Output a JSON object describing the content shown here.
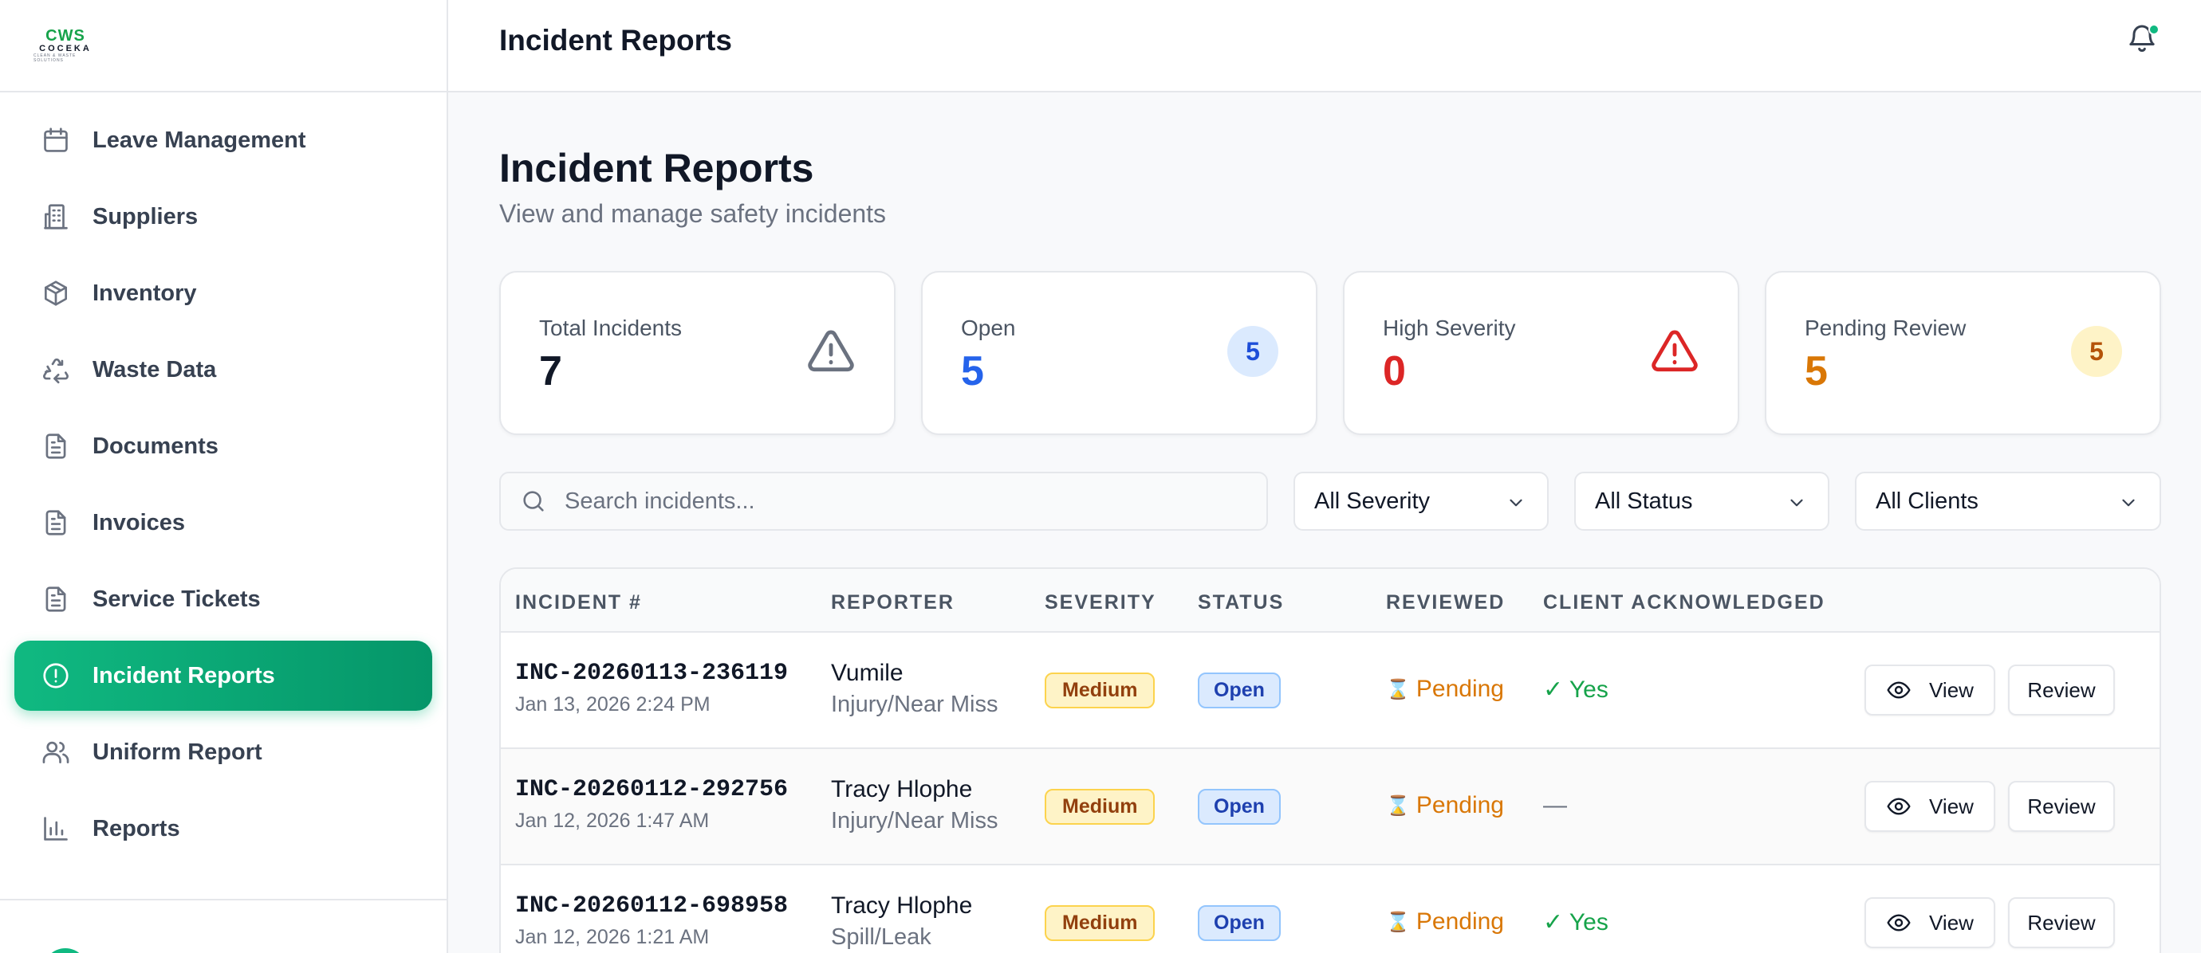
{
  "brand": {
    "mark": "CWS",
    "word": "COCEKA",
    "tag": "CLEAN & WASTE SOLUTIONS"
  },
  "sidebar": {
    "items": [
      {
        "label": "Leave Management",
        "icon": "calendar-icon"
      },
      {
        "label": "Suppliers",
        "icon": "building-icon"
      },
      {
        "label": "Inventory",
        "icon": "box-icon"
      },
      {
        "label": "Waste Data",
        "icon": "recycle-icon"
      },
      {
        "label": "Documents",
        "icon": "document-icon"
      },
      {
        "label": "Invoices",
        "icon": "document-icon"
      },
      {
        "label": "Service Tickets",
        "icon": "document-icon"
      },
      {
        "label": "Incident Reports",
        "icon": "alert-circle-icon"
      },
      {
        "label": "Uniform Report",
        "icon": "users-icon"
      },
      {
        "label": "Reports",
        "icon": "bar-chart-icon"
      }
    ],
    "active": "Incident Reports"
  },
  "header": {
    "title": "Incident Reports"
  },
  "page": {
    "title": "Incident Reports",
    "subtitle": "View and manage safety incidents"
  },
  "stats": [
    {
      "label": "Total Incidents",
      "value": "7",
      "color": "#111827",
      "icon": "warning-triangle-icon"
    },
    {
      "label": "Open",
      "value": "5",
      "color": "#2563eb",
      "badge": "5",
      "badge_bg": "#dbeafe"
    },
    {
      "label": "High Severity",
      "value": "0",
      "color": "#dc2626",
      "icon": "warning-triangle-icon"
    },
    {
      "label": "Pending Review",
      "value": "5",
      "color": "#d97706",
      "badge": "5",
      "badge_bg": "#fef3c7"
    }
  ],
  "filters": {
    "search_placeholder": "Search incidents...",
    "severity": "All Severity",
    "status": "All Status",
    "clients": "All Clients"
  },
  "table": {
    "headers": [
      "INCIDENT #",
      "REPORTER",
      "SEVERITY",
      "STATUS",
      "REVIEWED",
      "CLIENT ACKNOWLEDGED"
    ],
    "rows": [
      {
        "id": "INC-20260113-236119",
        "date": "Jan 13, 2026 2:24 PM",
        "reporter": "Vumile",
        "type": "Injury/Near Miss",
        "severity": "Medium",
        "status": "Open",
        "reviewed": "Pending",
        "ack": "✓ Yes"
      },
      {
        "id": "INC-20260112-292756",
        "date": "Jan 12, 2026 1:47 AM",
        "reporter": "Tracy Hlophe",
        "type": "Injury/Near Miss",
        "severity": "Medium",
        "status": "Open",
        "reviewed": "Pending",
        "ack": "—"
      },
      {
        "id": "INC-20260112-698958",
        "date": "Jan 12, 2026 1:21 AM",
        "reporter": "Tracy Hlophe",
        "type": "Spill/Leak",
        "severity": "Medium",
        "status": "Open",
        "reviewed": "Pending",
        "ack": "✓ Yes"
      }
    ],
    "view_label": "View",
    "review_label": "Review"
  }
}
